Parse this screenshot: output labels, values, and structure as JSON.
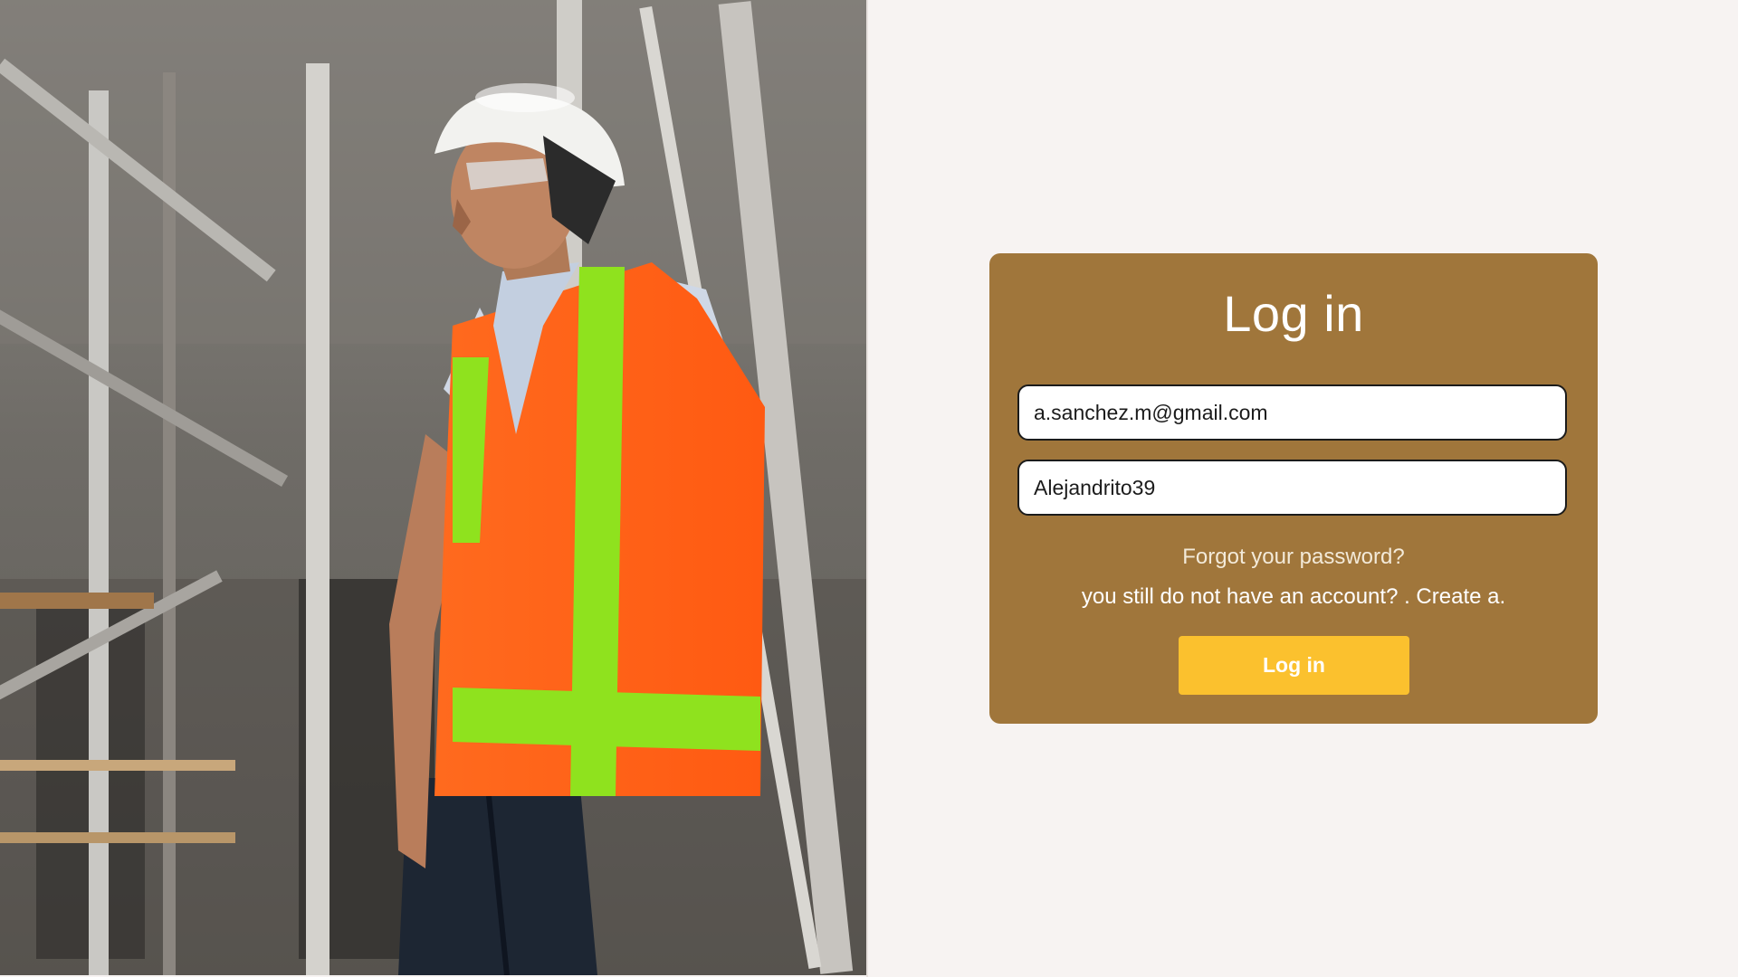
{
  "hero": {
    "description_icon": "construction-worker-photo"
  },
  "login": {
    "title": "Log in",
    "email_value": "a.sanchez.m@gmail.com",
    "password_value": "Alejandrito39",
    "forgot_label": "Forgot your password?",
    "signup_prefix": "you still do not have an account? .",
    "signup_link": "Create a.",
    "submit_label": "Log in"
  },
  "colors": {
    "background": "#f7f3f2",
    "card": "#a0763b",
    "button": "#fbc12e",
    "text_light": "#ffffff"
  }
}
